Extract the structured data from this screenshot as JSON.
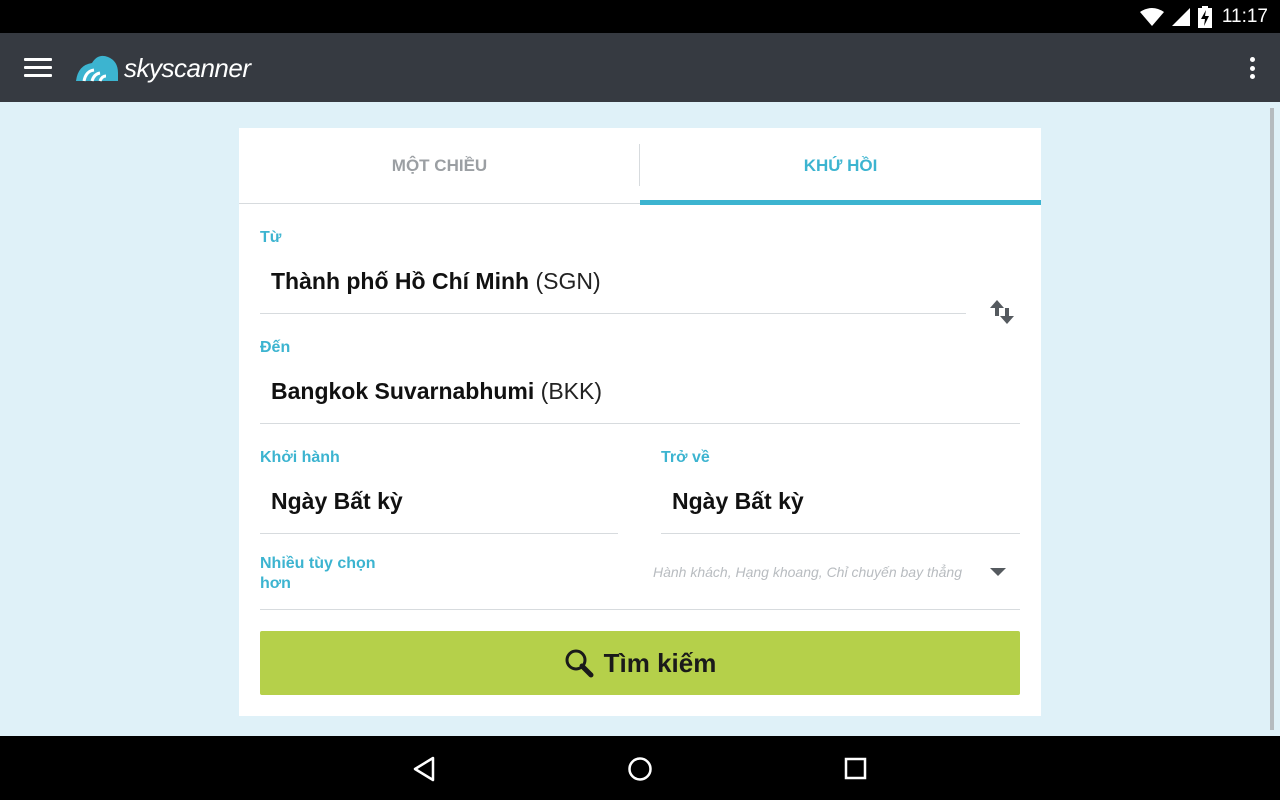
{
  "statusbar": {
    "time": "11:17"
  },
  "appbar": {
    "brand": "skyscanner"
  },
  "tabs": {
    "one_way": "MỘT CHIỀU",
    "round_trip": "KHỨ HỒI"
  },
  "from": {
    "label": "Từ",
    "city": "Thành phố Hồ Chí Minh",
    "code": "(SGN)"
  },
  "to": {
    "label": "Đến",
    "city": "Bangkok Suvarnabhumi",
    "code": "(BKK)"
  },
  "depart": {
    "label": "Khởi hành",
    "value": "Ngày Bất kỳ"
  },
  "return": {
    "label": "Trở về",
    "value": "Ngày Bất kỳ"
  },
  "more_options": {
    "label_line1": "Nhiều tùy chọn",
    "label_line2": "hơn",
    "hint": "Hành khách, Hạng khoang, Chỉ chuyến bay thẳng"
  },
  "search": {
    "label": "Tìm kiếm"
  },
  "colors": {
    "accent": "#3cb4d0",
    "appbar": "#363a41",
    "search_button": "#b5d04a",
    "background": "#dff1f8"
  }
}
